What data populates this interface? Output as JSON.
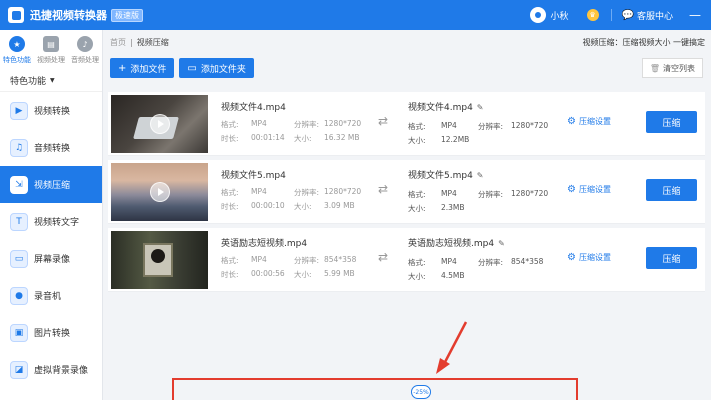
{
  "titlebar": {
    "app_title": "迅捷视频转换器",
    "version_badge": "极速版",
    "username": "小秋",
    "vip_icon": "vip-crown-icon",
    "help_label": "客服中心",
    "min_glyph": "—"
  },
  "sidebar": {
    "top_tabs": [
      {
        "label": "特色功能",
        "icon": "star-icon",
        "color": "#1f7ae8"
      },
      {
        "label": "视频处理",
        "icon": "film-icon",
        "color": "#9aa3ad"
      },
      {
        "label": "音频处理",
        "icon": "music-icon",
        "color": "#9aa3ad"
      }
    ],
    "category_header": "特色功能",
    "items": [
      {
        "label": "视频转换",
        "icon": "video-convert-icon"
      },
      {
        "label": "音频转换",
        "icon": "audio-convert-icon"
      },
      {
        "label": "视频压缩",
        "icon": "video-compress-icon",
        "active": true
      },
      {
        "label": "视频转文字",
        "icon": "video-to-text-icon"
      },
      {
        "label": "屏幕录像",
        "icon": "screen-record-icon"
      },
      {
        "label": "录音机",
        "icon": "recorder-icon"
      },
      {
        "label": "图片转换",
        "icon": "image-convert-icon"
      },
      {
        "label": "虚拟背景录像",
        "icon": "virtual-bg-record-icon"
      }
    ]
  },
  "breadcrumb": {
    "home": "首页",
    "current": "视频压缩"
  },
  "hint": "视频压缩：压缩视频大小 一键搞定",
  "toolbar": {
    "add_file": "添加文件",
    "add_folder": "添加文件夹",
    "clear_list": "清空列表"
  },
  "labels": {
    "format": "格式:",
    "resolution": "分辨率:",
    "duration": "时长:",
    "size": "大小:",
    "out_format": "格式:",
    "out_resolution": "分辨率:",
    "out_size": "大小:",
    "settings": "压缩设置",
    "compress": "压缩"
  },
  "files": [
    {
      "src_name": "视频文件4.mp4",
      "format": "MP4",
      "resolution": "1280*720",
      "duration": "00:01:14",
      "size": "16.32 MB",
      "dst_name": "视频文件4.mp4",
      "out_format": "MP4",
      "out_resolution": "1280*720",
      "out_size": "12.2MB"
    },
    {
      "src_name": "视频文件5.mp4",
      "format": "MP4",
      "resolution": "1280*720",
      "duration": "00:00:10",
      "size": "3.09 MB",
      "dst_name": "视频文件5.mp4",
      "out_format": "MP4",
      "out_resolution": "1280*720",
      "out_size": "2.3MB"
    },
    {
      "src_name": "英语励志短视频.mp4",
      "format": "MP4",
      "resolution": "854*358",
      "duration": "00:00:56",
      "size": "5.99 MB",
      "dst_name": "英语励志短视频.mp4",
      "out_format": "MP4",
      "out_resolution": "854*358",
      "out_size": "4.5MB"
    }
  ],
  "compress_badge": "-25%"
}
